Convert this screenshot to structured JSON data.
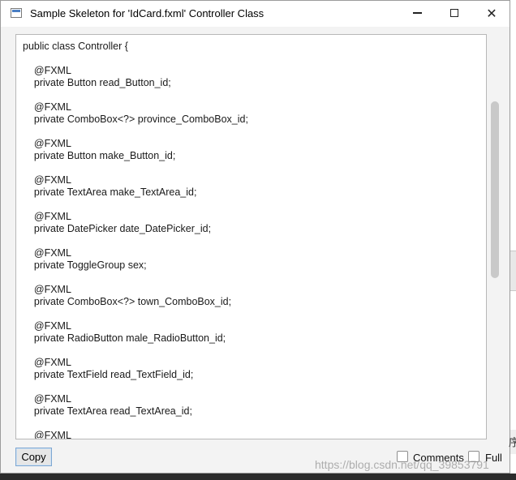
{
  "window": {
    "title": "Sample Skeleton for 'IdCard.fxml' Controller Class",
    "minimize_glyph": "",
    "maximize_glyph": "",
    "close_glyph": "✕"
  },
  "code": {
    "lines": [
      "public class Controller {",
      "",
      "    @FXML",
      "    private Button read_Button_id;",
      "",
      "    @FXML",
      "    private ComboBox<?> province_ComboBox_id;",
      "",
      "    @FXML",
      "    private Button make_Button_id;",
      "",
      "    @FXML",
      "    private TextArea make_TextArea_id;",
      "",
      "    @FXML",
      "    private DatePicker date_DatePicker_id;",
      "",
      "    @FXML",
      "    private ToggleGroup sex;",
      "",
      "    @FXML",
      "    private ComboBox<?> town_ComboBox_id;",
      "",
      "    @FXML",
      "    private RadioButton male_RadioButton_id;",
      "",
      "    @FXML",
      "    private TextField read_TextField_id;",
      "",
      "    @FXML",
      "    private TextArea read_TextArea_id;",
      "",
      "    @FXML"
    ]
  },
  "footer": {
    "copy_label": "Copy",
    "comments_label": "Comments",
    "full_label": "Full",
    "comments_checked": false,
    "full_checked": false
  },
  "background": {
    "edge_char": "序"
  },
  "watermark": "https://blog.csdn.net/qq_39853791"
}
